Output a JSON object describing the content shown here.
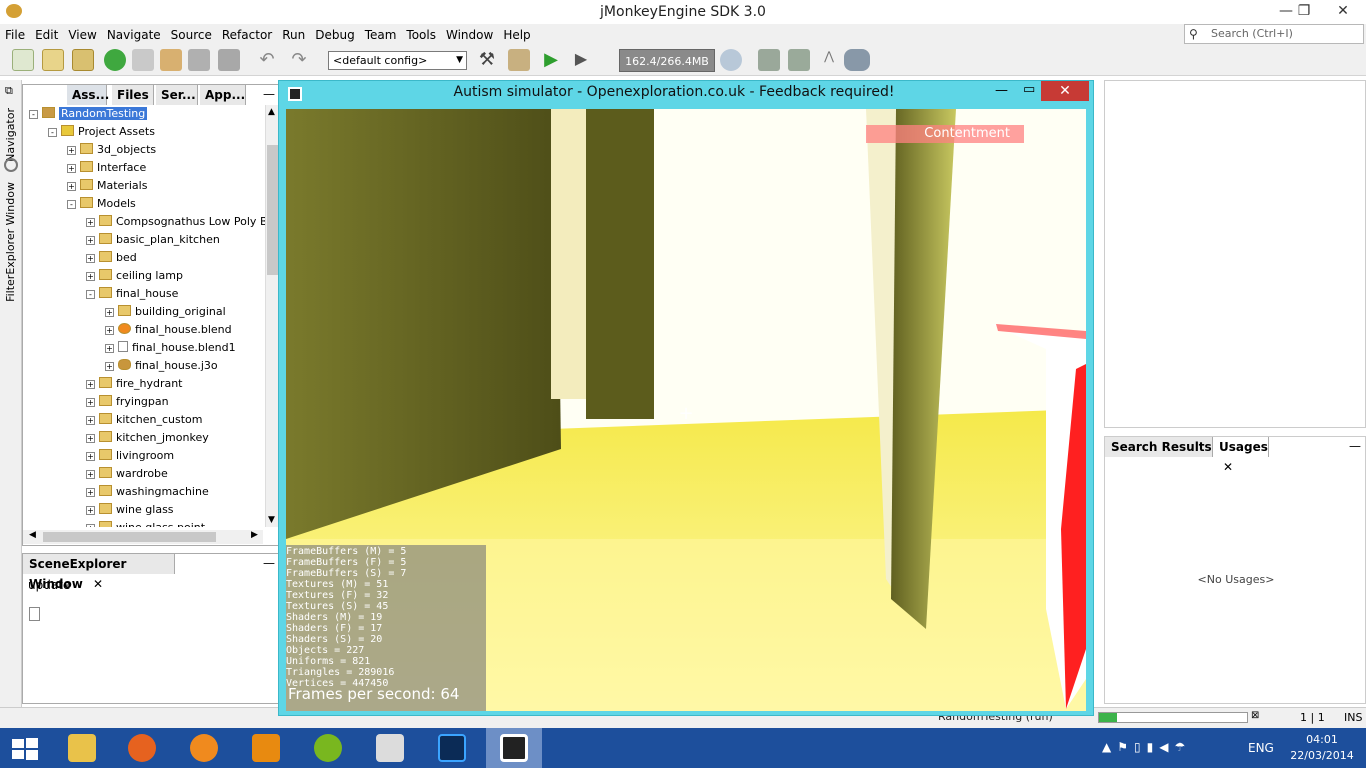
{
  "app": {
    "title": "jMonkeyEngine SDK 3.0"
  },
  "menu": [
    "File",
    "Edit",
    "View",
    "Navigate",
    "Source",
    "Refactor",
    "Run",
    "Debug",
    "Team",
    "Tools",
    "Window",
    "Help"
  ],
  "search": {
    "placeholder": "Search (Ctrl+I)"
  },
  "toolbar": {
    "config": "<default config>",
    "memory": "162.4/266.4MB"
  },
  "left_strip": {
    "navigator": "Navigator",
    "filter_explorer": "FilterExplorer Window"
  },
  "project_panel": {
    "tabs": [
      "Ass...",
      "Files",
      "Ser...",
      "App..."
    ],
    "tree": [
      {
        "label": "RandomTesting",
        "level": 0,
        "kind": "project",
        "expander": "-"
      },
      {
        "label": "Project Assets",
        "level": 1,
        "kind": "assets",
        "expander": "-"
      },
      {
        "label": "3d_objects",
        "level": 2,
        "kind": "folder",
        "expander": "+"
      },
      {
        "label": "Interface",
        "level": 2,
        "kind": "folder",
        "expander": "+"
      },
      {
        "label": "Materials",
        "level": 2,
        "kind": "folder",
        "expander": "+"
      },
      {
        "label": "Models",
        "level": 2,
        "kind": "folder",
        "expander": "-"
      },
      {
        "label": "Compsognathus Low Poly Ble",
        "level": 3,
        "kind": "folder",
        "expander": "+"
      },
      {
        "label": "basic_plan_kitchen",
        "level": 3,
        "kind": "folder",
        "expander": "+"
      },
      {
        "label": "bed",
        "level": 3,
        "kind": "folder",
        "expander": "+"
      },
      {
        "label": "ceiling lamp",
        "level": 3,
        "kind": "folder",
        "expander": "+"
      },
      {
        "label": "final_house",
        "level": 3,
        "kind": "folder",
        "expander": "-"
      },
      {
        "label": "building_original",
        "level": 4,
        "kind": "folder",
        "expander": "+"
      },
      {
        "label": "final_house.blend",
        "level": 4,
        "kind": "blend",
        "expander": "+"
      },
      {
        "label": "final_house.blend1",
        "level": 4,
        "kind": "file",
        "expander": "+"
      },
      {
        "label": "final_house.j3o",
        "level": 4,
        "kind": "j3o",
        "expander": "+"
      },
      {
        "label": "fire_hydrant",
        "level": 3,
        "kind": "folder",
        "expander": "+"
      },
      {
        "label": "fryingpan",
        "level": 3,
        "kind": "folder",
        "expander": "+"
      },
      {
        "label": "kitchen_custom",
        "level": 3,
        "kind": "folder",
        "expander": "+"
      },
      {
        "label": "kitchen_jmonkey",
        "level": 3,
        "kind": "folder",
        "expander": "+"
      },
      {
        "label": "livingroom",
        "level": 3,
        "kind": "folder",
        "expander": "+"
      },
      {
        "label": "wardrobe",
        "level": 3,
        "kind": "folder",
        "expander": "+"
      },
      {
        "label": "washingmachine",
        "level": 3,
        "kind": "folder",
        "expander": "+"
      },
      {
        "label": "wine glass",
        "level": 3,
        "kind": "folder",
        "expander": "+"
      },
      {
        "label": "wine glass point",
        "level": 3,
        "kind": "folder",
        "expander": "+"
      }
    ]
  },
  "scene_panel": {
    "title": "SceneExplorer Window",
    "content": "update"
  },
  "game_window": {
    "title": "Autism simulator - Openexploration.co.uk - Feedback required!",
    "contentment": "Contentment",
    "stats": [
      "FrameBuffers (M) = 5",
      "FrameBuffers (F) = 5",
      "FrameBuffers (S) = 7",
      "Textures (M) = 51",
      "Textures (F) = 32",
      "Textures (S) = 45",
      "Shaders (M) = 19",
      "Shaders (F) = 17",
      "Shaders (S) = 20",
      "Objects = 227",
      "Uniforms = 821",
      "Triangles = 289016",
      "Vertices = 447450"
    ],
    "fps": "Frames per second: 64"
  },
  "search_panel": {
    "tabs": [
      "Search Results",
      "Usages"
    ],
    "empty": "<No Usages>"
  },
  "statusbar": {
    "task": "RandomTesting (run)",
    "position": "1 | 1",
    "mode": "INS"
  },
  "taskbar": {
    "lang": "ENG",
    "time": "04:01",
    "date": "22/03/2014"
  }
}
